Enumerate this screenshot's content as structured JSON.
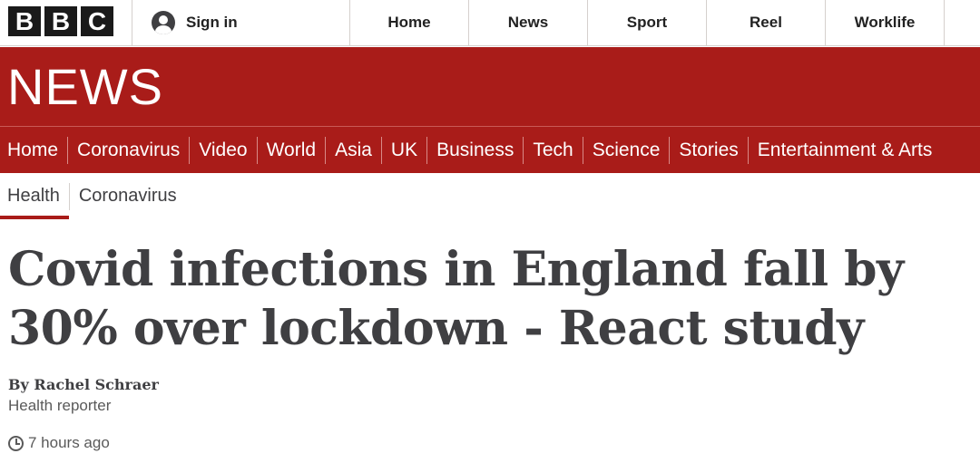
{
  "brand": {
    "logo_letters": [
      "B",
      "B",
      "C"
    ],
    "wordmark": "NEWS",
    "accent_color": "#a91c19"
  },
  "topbar": {
    "signin_label": "Sign in",
    "signin_icon": "user-avatar-icon",
    "nav": [
      "Home",
      "News",
      "Sport",
      "Reel",
      "Worklife"
    ]
  },
  "section_nav": [
    "Home",
    "Coronavirus",
    "Video",
    "World",
    "Asia",
    "UK",
    "Business",
    "Tech",
    "Science",
    "Stories",
    "Entertainment & Arts"
  ],
  "sub_nav": {
    "active": "Health",
    "items": [
      "Health",
      "Coronavirus"
    ]
  },
  "article": {
    "headline": "Covid infections in England fall by 30% over lockdown - React study",
    "byline_name": "By Rachel Schraer",
    "byline_role": "Health reporter",
    "timestamp": "7 hours ago",
    "timestamp_icon": "clock-icon"
  }
}
